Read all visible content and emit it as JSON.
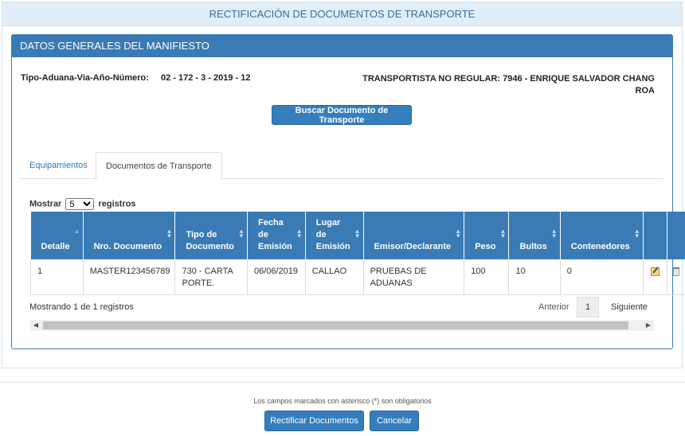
{
  "header": {
    "title": "RECTIFICACIÓN DE DOCUMENTOS DE TRANSPORTE"
  },
  "panel": {
    "title": "DATOS GENERALES DEL MANIFIESTO",
    "manifest_label": "Tipo-Aduana-Via-Año-Número:",
    "manifest_value": "02 - 172 - 3 - 2019 - 12",
    "transportista_line1": "TRANSPORTISTA NO REGULAR: 7946 - ENRIQUE SALVADOR CHANG",
    "transportista_line2": "ROA",
    "search_button": "Buscar Documento de Transporte"
  },
  "tabs": [
    {
      "label": "Equipamientos",
      "active": false
    },
    {
      "label": "Documentos de Transporte",
      "active": true
    }
  ],
  "table": {
    "show_prefix": "Mostrar",
    "page_size": "5",
    "show_suffix": "registros",
    "columns": [
      [
        "Detalle"
      ],
      [
        "Nro. Documento"
      ],
      [
        "Tipo de",
        "Documento"
      ],
      [
        "Fecha",
        "de",
        "Emisión"
      ],
      [
        "Lugar",
        "de",
        "Emisión"
      ],
      [
        "Emisor/Declarante"
      ],
      [
        "Peso"
      ],
      [
        "Bultos"
      ],
      [
        "Contenedores"
      ],
      [
        ""
      ],
      [
        ""
      ]
    ],
    "rows": [
      {
        "detalle": "1",
        "nro_documento": "MASTER123456789",
        "tipo_documento": [
          "730 - CARTA",
          "PORTE."
        ],
        "fecha_emision": "06/06/2019",
        "lugar_emision": "CALLAO",
        "emisor": [
          "PRUEBAS DE",
          "ADUANAS"
        ],
        "peso": "100",
        "bultos": "10",
        "contenedores": "0",
        "edit_icon": "edit-icon",
        "delete_icon": "trash-icon"
      }
    ],
    "info": "Mostrando 1 de 1 registros",
    "pagination": {
      "previous": "Anterior",
      "current": "1",
      "next": "Siguiente"
    }
  },
  "footer": {
    "note": "Los campos marcados con asterisco (*) son obligatorios",
    "rectify_button": "Rectificar Documentos",
    "cancel_button": "Cancelar"
  },
  "colors": {
    "primary": "#3a7ab5",
    "header_bg": "#dfeef8",
    "header_text": "#3c6f99",
    "button": "#357ebd"
  }
}
